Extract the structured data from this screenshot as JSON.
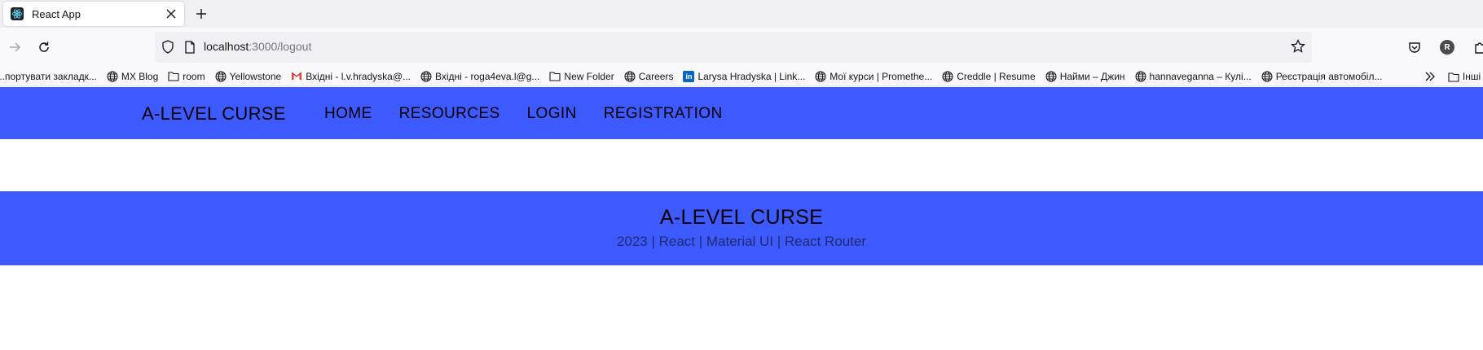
{
  "browser": {
    "tab": {
      "title": "React App"
    },
    "address": {
      "host": "localhost",
      "path": ":3000/logout"
    },
    "avatar_letter": "R",
    "bookmarks": [
      {
        "label": "...портувати закладк...",
        "icon": "none"
      },
      {
        "label": "MX Blog",
        "icon": "globe-icon"
      },
      {
        "label": "room",
        "icon": "folder-icon"
      },
      {
        "label": "Yellowstone",
        "icon": "globe-icon"
      },
      {
        "label": "Вхідні - l.v.hradyska@...",
        "icon": "gmail-icon"
      },
      {
        "label": "Вхідні - roga4eva.l@g...",
        "icon": "globe-icon"
      },
      {
        "label": "New Folder",
        "icon": "folder-icon"
      },
      {
        "label": "Careers",
        "icon": "globe-icon"
      },
      {
        "label": "Larysa Hradyska | Link...",
        "icon": "linkedin-icon"
      },
      {
        "label": "Мої курси | Promethe...",
        "icon": "globe-icon"
      },
      {
        "label": "Creddle | Resume",
        "icon": "globe-icon"
      },
      {
        "label": "Найми – Джин",
        "icon": "globe-icon"
      },
      {
        "label": "hannaveganna – Кулі...",
        "icon": "globe-icon"
      },
      {
        "label": "Реєстрація автомобіл...",
        "icon": "globe-icon"
      }
    ],
    "other_bookmarks": "Інші з"
  },
  "header": {
    "brand": "A-LEVEL CURSE",
    "menu": [
      "HOME",
      "RESOURCES",
      "LOGIN",
      "REGISTRATION"
    ]
  },
  "footer": {
    "title": "A-LEVEL CURSE",
    "subtitle": "2023 | React | Material UI | React Router"
  },
  "colors": {
    "primary": "#3d5afe",
    "chrome": "#f0f0f4",
    "toolbar": "#f9f9fb"
  }
}
